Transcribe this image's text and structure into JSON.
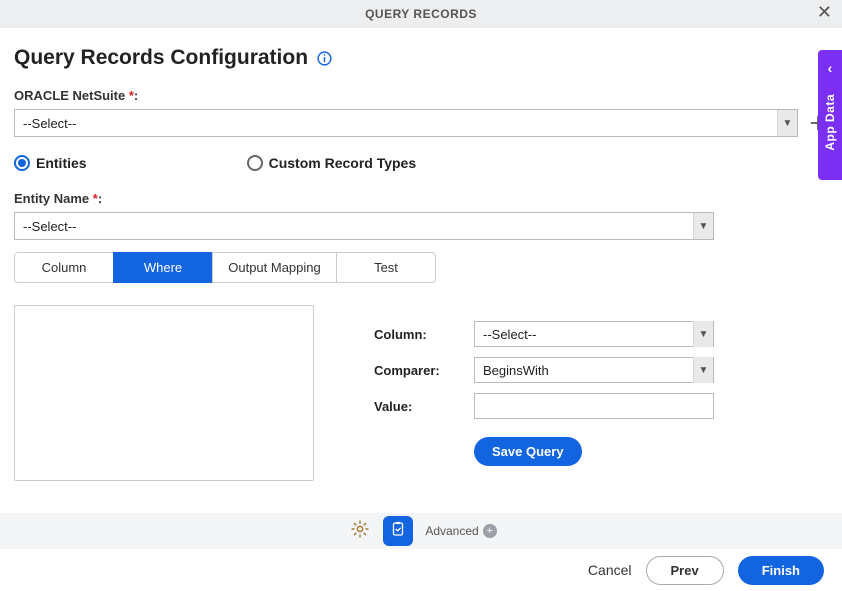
{
  "header": {
    "title": "QUERY RECORDS"
  },
  "sideTab": {
    "label": "App Data"
  },
  "page": {
    "title": "Query Records Configuration",
    "oracle_label": "ORACLE NetSuite",
    "oracle_value": "--Select--",
    "radios": {
      "entities": "Entities",
      "custom": "Custom Record Types",
      "selected": "entities"
    },
    "entity_label": "Entity Name",
    "entity_value": "--Select--"
  },
  "tabs": [
    "Column",
    "Where",
    "Output Mapping",
    "Test"
  ],
  "active_tab": 1,
  "where": {
    "column_label": "Column:",
    "column_value": "--Select--",
    "comparer_label": "Comparer:",
    "comparer_value": "BeginsWith",
    "value_label": "Value:",
    "value_input": "",
    "save_query": "Save Query"
  },
  "toolbar": {
    "advanced": "Advanced"
  },
  "footer": {
    "cancel": "Cancel",
    "prev": "Prev",
    "finish": "Finish"
  }
}
